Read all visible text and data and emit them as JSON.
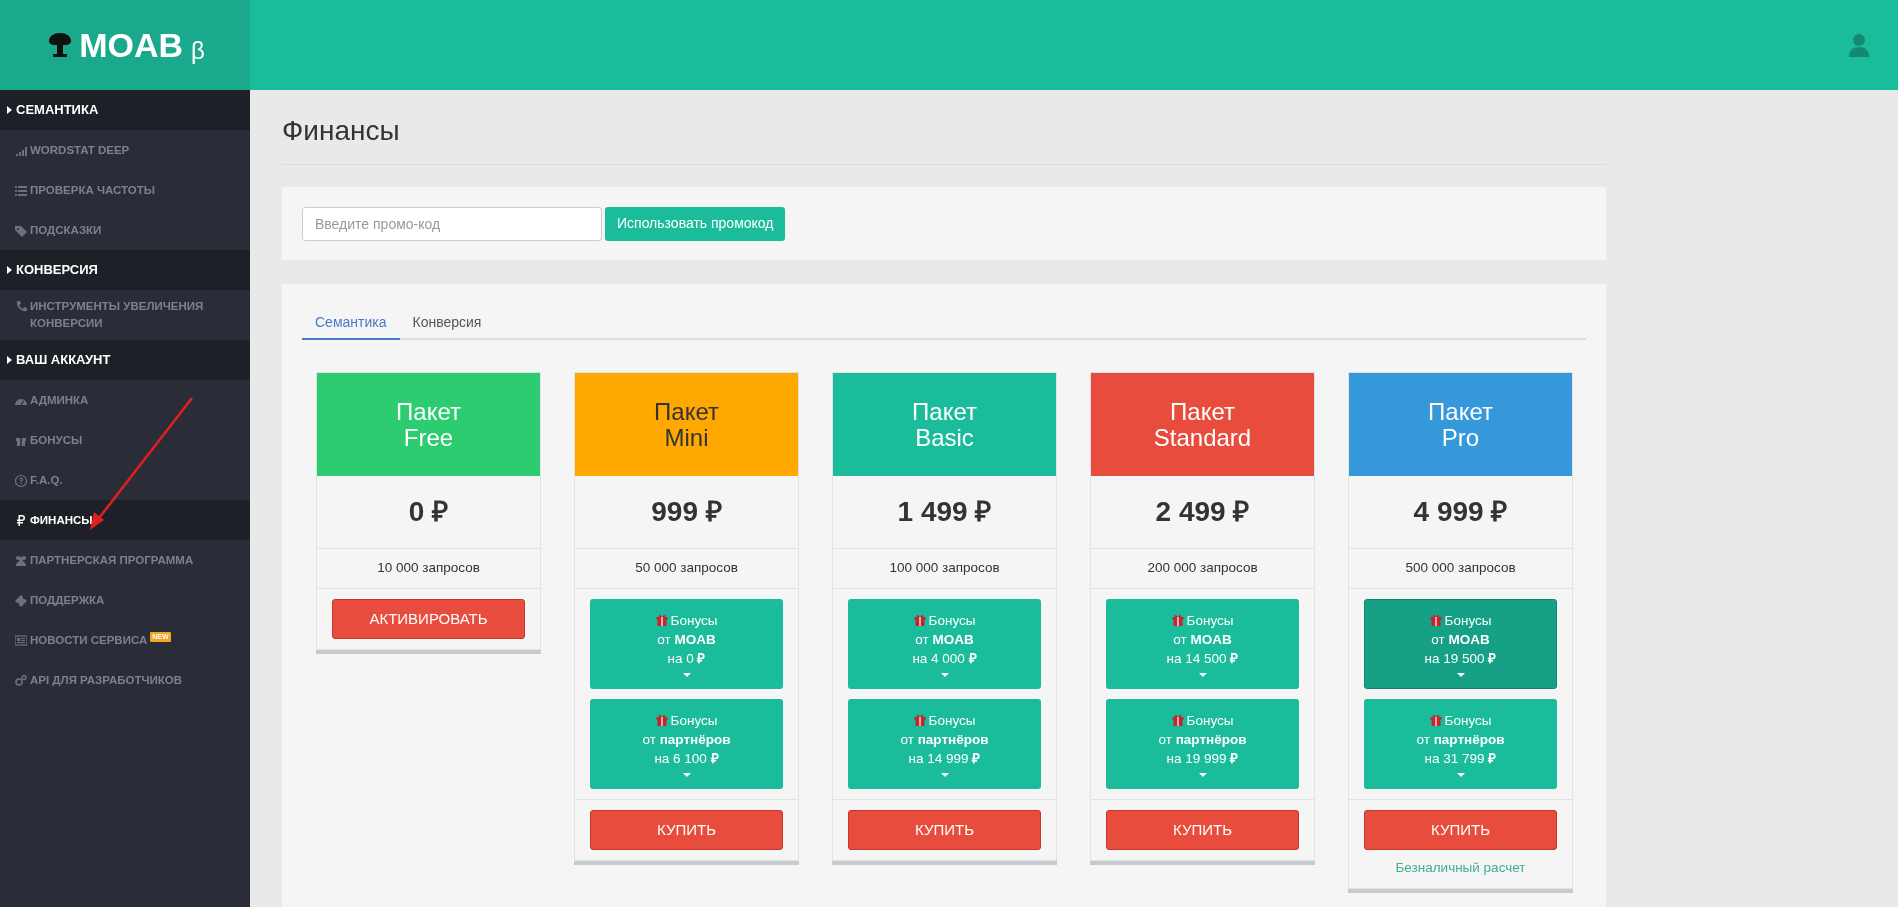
{
  "logo": {
    "name": "MOAB",
    "suffix": "β"
  },
  "sidebar": {
    "items": [
      {
        "kind": "section",
        "label": "СЕМАНТИКА"
      },
      {
        "kind": "item",
        "label": "WORDSTAT DEEP",
        "selected": false
      },
      {
        "kind": "item",
        "label": "ПРОВЕРКА ЧАСТОТЫ",
        "selected": false
      },
      {
        "kind": "item",
        "label": "ПОДСКАЗКИ",
        "selected": false
      },
      {
        "kind": "section",
        "label": "КОНВЕРСИЯ"
      },
      {
        "kind": "item",
        "label": "ИНСТРУМЕНТЫ УВЕЛИЧЕНИЯ КОНВЕРСИИ",
        "selected": false
      },
      {
        "kind": "section",
        "label": "ВАШ АККАУНТ"
      },
      {
        "kind": "item",
        "label": "АДМИНКА",
        "selected": false
      },
      {
        "kind": "item",
        "label": "БОНУСЫ",
        "selected": false
      },
      {
        "kind": "item",
        "label": "F.A.Q.",
        "selected": false
      },
      {
        "kind": "item",
        "label": "ФИНАНСЫ",
        "selected": true
      },
      {
        "kind": "item",
        "label": "ПАРТНЕРСКАЯ ПРОГРАММА",
        "selected": false
      },
      {
        "kind": "item",
        "label": "ПОДДЕРЖКА",
        "selected": false
      },
      {
        "kind": "item",
        "label": "НОВОСТИ СЕРВИСА",
        "badge": "NEW",
        "selected": false
      },
      {
        "kind": "item",
        "label": "API ДЛЯ РАЗРАБОТЧИКОВ",
        "selected": false
      }
    ]
  },
  "page_title": "Финансы",
  "promo": {
    "placeholder": "Введите промо-код",
    "button": "Использовать промокод"
  },
  "tabs": [
    {
      "label": "Семантика",
      "selected": true
    },
    {
      "label": "Конверсия",
      "selected": false
    }
  ],
  "plans": [
    {
      "title": [
        "Пакет",
        "Free"
      ],
      "color": "#2ecc71",
      "dark_text": false,
      "price": "0 ₽",
      "requests": "10 000 запросов",
      "button": "АКТИВИРОВАТЬ"
    },
    {
      "title": [
        "Пакет",
        "Mini"
      ],
      "color": "#ffa800",
      "dark_text": true,
      "price": "999 ₽",
      "requests": "50 000 запросов",
      "bonuses": [
        {
          "lines": [
            "Бонусы",
            "от **MOAB**",
            "на 0 **₽**"
          ],
          "active": false
        },
        {
          "lines": [
            "Бонусы",
            "от **партнёров**",
            "на 6 100 **₽**"
          ],
          "active": false
        }
      ],
      "button": "КУПИТЬ"
    },
    {
      "title": [
        "Пакет",
        "Basic"
      ],
      "color": "#1abc9c",
      "dark_text": false,
      "price": "1 499 ₽",
      "requests": "100 000 запросов",
      "bonuses": [
        {
          "lines": [
            "Бонусы",
            "от **MOAB**",
            "на 4 000 **₽**"
          ],
          "active": false
        },
        {
          "lines": [
            "Бонусы",
            "от **партнёров**",
            "на 14 999 **₽**"
          ],
          "active": false
        }
      ],
      "button": "КУПИТЬ"
    },
    {
      "title": [
        "Пакет",
        "Standard"
      ],
      "color": "#e74c3c",
      "dark_text": false,
      "price": "2 499 ₽",
      "requests": "200 000 запросов",
      "bonuses": [
        {
          "lines": [
            "Бонусы",
            "от **MOAB**",
            "на 14 500 **₽**"
          ],
          "active": false
        },
        {
          "lines": [
            "Бонусы",
            "от **партнёров**",
            "на 19 999 **₽**"
          ],
          "active": false
        }
      ],
      "button": "КУПИТЬ"
    },
    {
      "title": [
        "Пакет",
        "Pro"
      ],
      "color": "#3498db",
      "dark_text": false,
      "price": "4 999 ₽",
      "requests": "500 000 запросов",
      "bonuses": [
        {
          "lines": [
            "Бонусы",
            "от **MOAB**",
            "на 19 500 **₽**"
          ],
          "active": true
        },
        {
          "lines": [
            "Бонусы",
            "от **партнёров**",
            "на 31 799 **₽**"
          ],
          "active": false
        }
      ],
      "button": "КУПИТЬ",
      "link": "Безналичный расчет"
    }
  ]
}
